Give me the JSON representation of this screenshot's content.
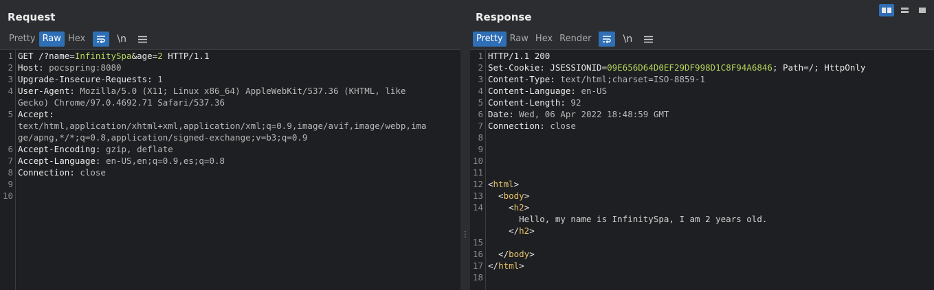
{
  "request": {
    "title": "Request",
    "tabs": [
      "Pretty",
      "Raw",
      "Hex"
    ],
    "active_tab": "Raw",
    "lines": [
      {
        "n": "1",
        "parts": [
          [
            "k",
            "GET /?name="
          ],
          [
            "h",
            "InfinitySpa"
          ],
          [
            "k",
            "&age="
          ],
          [
            "h",
            "2"
          ],
          [
            "k",
            " HTTP/1.1"
          ]
        ]
      },
      {
        "n": "2",
        "parts": [
          [
            "k",
            "Host: "
          ],
          [
            "v",
            "pocspring:8080"
          ]
        ]
      },
      {
        "n": "3",
        "parts": [
          [
            "k",
            "Upgrade-Insecure-Requests: "
          ],
          [
            "v",
            "1"
          ]
        ]
      },
      {
        "n": "4",
        "parts": [
          [
            "k",
            "User-Agent: "
          ],
          [
            "v",
            "Mozilla/5.0 (X11; Linux x86_64) AppleWebKit/537.36 (KHTML, like"
          ]
        ]
      },
      {
        "n": "",
        "parts": [
          [
            "v",
            "Gecko) Chrome/97.0.4692.71 Safari/537.36"
          ]
        ]
      },
      {
        "n": "5",
        "parts": [
          [
            "k",
            "Accept:"
          ]
        ]
      },
      {
        "n": "",
        "parts": [
          [
            "v",
            "text/html,application/xhtml+xml,application/xml;q=0.9,image/avif,image/webp,ima"
          ]
        ]
      },
      {
        "n": "",
        "parts": [
          [
            "v",
            "ge/apng,*/*;q=0.8,application/signed-exchange;v=b3;q=0.9"
          ]
        ]
      },
      {
        "n": "6",
        "parts": [
          [
            "k",
            "Accept-Encoding: "
          ],
          [
            "v",
            "gzip, deflate"
          ]
        ]
      },
      {
        "n": "7",
        "parts": [
          [
            "k",
            "Accept-Language: "
          ],
          [
            "v",
            "en-US,en;q=0.9,es;q=0.8"
          ]
        ]
      },
      {
        "n": "8",
        "parts": [
          [
            "k",
            "Connection: "
          ],
          [
            "v",
            "close"
          ]
        ]
      },
      {
        "n": "9",
        "parts": []
      },
      {
        "n": "10",
        "parts": []
      }
    ]
  },
  "response": {
    "title": "Response",
    "tabs": [
      "Pretty",
      "Raw",
      "Hex",
      "Render"
    ],
    "active_tab": "Pretty",
    "lines": [
      {
        "n": "1",
        "parts": [
          [
            "k",
            "HTTP/1.1 200"
          ]
        ]
      },
      {
        "n": "2",
        "parts": [
          [
            "k",
            "Set-Cookie: "
          ],
          [
            "k",
            "JSESSIONID="
          ],
          [
            "h",
            "09E656D64D0EF29DF998D1C8F94A6846"
          ],
          [
            "k",
            "; Path=/; HttpOnly"
          ]
        ]
      },
      {
        "n": "3",
        "parts": [
          [
            "k",
            "Content-Type: "
          ],
          [
            "v",
            "text/html;charset=ISO-8859-1"
          ]
        ]
      },
      {
        "n": "4",
        "parts": [
          [
            "k",
            "Content-Language: "
          ],
          [
            "v",
            "en-US"
          ]
        ]
      },
      {
        "n": "5",
        "parts": [
          [
            "k",
            "Content-Length: "
          ],
          [
            "v",
            "92"
          ]
        ]
      },
      {
        "n": "6",
        "parts": [
          [
            "k",
            "Date: "
          ],
          [
            "v",
            "Wed, 06 Apr 2022 18:48:59 GMT"
          ]
        ]
      },
      {
        "n": "7",
        "parts": [
          [
            "k",
            "Connection: "
          ],
          [
            "v",
            "close"
          ]
        ]
      },
      {
        "n": "8",
        "parts": []
      },
      {
        "n": "9",
        "parts": []
      },
      {
        "n": "10",
        "parts": []
      },
      {
        "n": "11",
        "parts": []
      },
      {
        "n": "12",
        "parts": [
          [
            "k",
            "<"
          ],
          [
            "t",
            "html"
          ],
          [
            "k",
            ">"
          ]
        ]
      },
      {
        "n": "13",
        "parts": [
          [
            "k",
            "  <"
          ],
          [
            "t",
            "body"
          ],
          [
            "k",
            ">"
          ]
        ]
      },
      {
        "n": "14",
        "parts": [
          [
            "k",
            "    <"
          ],
          [
            "t",
            "h2"
          ],
          [
            "k",
            ">"
          ]
        ]
      },
      {
        "n": "",
        "parts": [
          [
            "x",
            "      Hello, my name is InfinitySpa, I am 2 years old."
          ]
        ]
      },
      {
        "n": "",
        "parts": [
          [
            "k",
            "    </"
          ],
          [
            "t",
            "h2"
          ],
          [
            "k",
            ">"
          ]
        ]
      },
      {
        "n": "15",
        "parts": []
      },
      {
        "n": "",
        "parts": [
          [
            "k",
            "  </"
          ],
          [
            "t",
            "body"
          ],
          [
            "k",
            ">"
          ]
        ]
      },
      {
        "n": "17",
        "parts": [
          [
            "k",
            "</"
          ],
          [
            "t",
            "html"
          ],
          [
            "k",
            ">"
          ]
        ]
      },
      {
        "n": "18",
        "parts": []
      }
    ]
  },
  "gutter_fix": {
    "16": "16"
  },
  "toolbar_icons": [
    "wrap-icon",
    "newline-icon",
    "menu-icon"
  ],
  "newline_label": "\\n",
  "colors": {
    "accent": "#2f6fb6",
    "highlight": "#b3d45c",
    "tag": "#e8c36c"
  }
}
